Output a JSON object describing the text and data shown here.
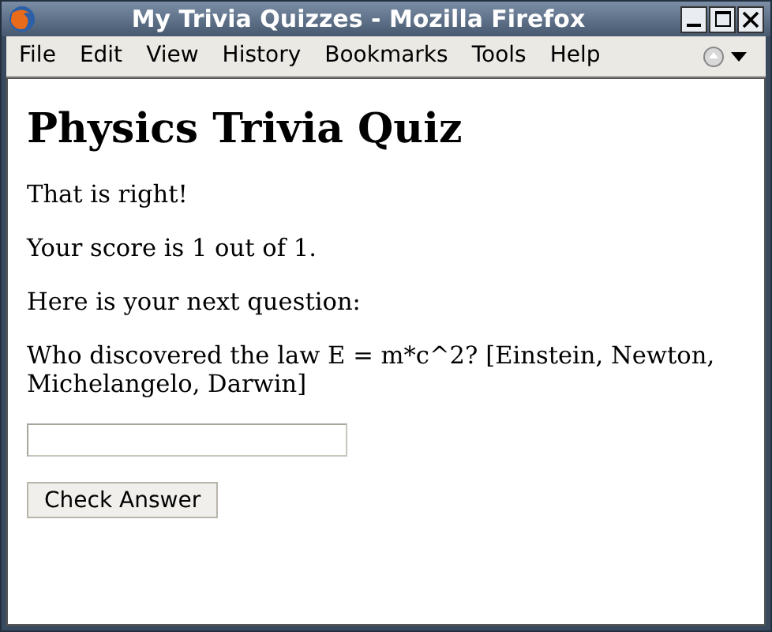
{
  "window": {
    "title": "My Trivia Quizzes - Mozilla Firefox"
  },
  "menu": [
    "File",
    "Edit",
    "View",
    "History",
    "Bookmarks",
    "Tools",
    "Help"
  ],
  "page": {
    "heading": "Physics Trivia Quiz",
    "paragraphs": [
      "That is right!",
      "Your score is 1 out of 1.",
      "Here is your next question:",
      "Who discovered the law E = m*c^2? [Einstein, Newton, Michelangelo, Darwin]"
    ],
    "button": "Check Answer"
  }
}
